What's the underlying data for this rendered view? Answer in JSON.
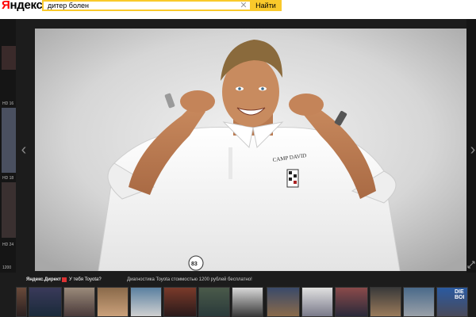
{
  "header": {
    "logo_first": "Я",
    "logo_rest": "ндекс",
    "search_value": "дитер болен",
    "search_button": "Найти",
    "clear_icon": "close-icon"
  },
  "viewer": {
    "prev_icon": "chevron-left-icon",
    "next_icon": "chevron-right-icon",
    "prev_glyph": "‹",
    "next_glyph": "›",
    "left_strip_labels": [
      "HD 16",
      "HD 18",
      "HD 24",
      "1200"
    ],
    "shirt_text": "CAMP DAVID",
    "badge_text": "83"
  },
  "ad": {
    "label": "Яндекс.Директ",
    "title": "У тебя Toyota?",
    "text": "Диагностика Toyota стоимостью 1200 рублей бесплатно!"
  },
  "thumbnails": {
    "count": 14,
    "last_text": "DIE BOI"
  },
  "colors": {
    "accent": "#f9c92b",
    "logo_red": "#ff0000",
    "background": "#1b1b1b",
    "photo_bg": "#d8d8d8"
  }
}
